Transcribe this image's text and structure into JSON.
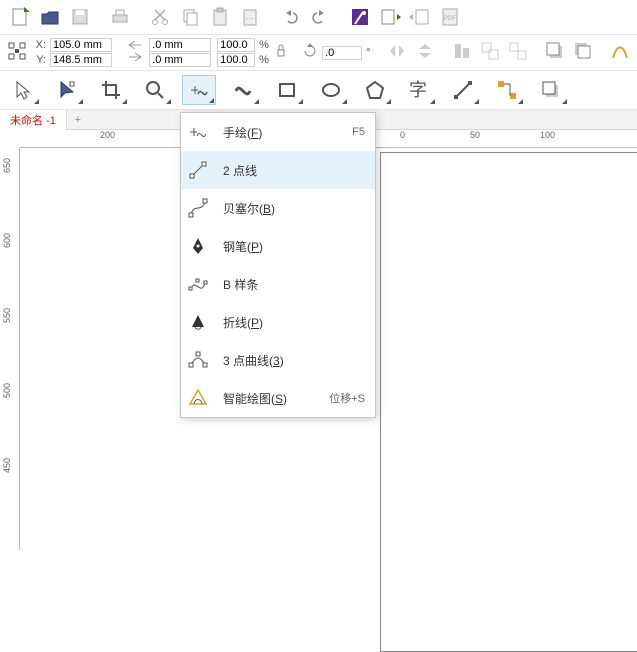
{
  "toolbar1": {
    "icons": [
      "new",
      "open",
      "save",
      "print",
      "cut",
      "copy",
      "paste",
      "paste-special",
      "undo",
      "redo",
      "fx",
      "plugin",
      "import",
      "export",
      "pdf"
    ]
  },
  "props": {
    "xy_icon": "obj-origin",
    "x_label": "X:",
    "x_value": "105.0 mm",
    "y_label": "Y:",
    "y_value": "148.5 mm",
    "w_label": "",
    "w_value": ".0 mm",
    "h_label": "",
    "h_value": ".0 mm",
    "sx_value": "100.0",
    "sy_value": "100.0",
    "pct": "%",
    "rot_value": ".0",
    "deg": "°"
  },
  "toolbox": [
    {
      "name": "pick",
      "active": false
    },
    {
      "name": "shape",
      "active": false
    },
    {
      "name": "crop",
      "active": false
    },
    {
      "name": "zoom",
      "active": false
    },
    {
      "name": "freehand",
      "active": true
    },
    {
      "name": "media",
      "active": false
    },
    {
      "name": "rect",
      "active": false
    },
    {
      "name": "ellipse",
      "active": false
    },
    {
      "name": "polygon",
      "active": false
    },
    {
      "name": "text",
      "active": false
    },
    {
      "name": "dimension",
      "active": false
    },
    {
      "name": "connector",
      "active": false
    },
    {
      "name": "effects",
      "active": false
    }
  ],
  "tabs": {
    "doc": "未命名 -1",
    "plus": "+"
  },
  "ruler_h": [
    {
      "pos": -40,
      "label": ""
    },
    {
      "pos": 80,
      "label": "200"
    },
    {
      "pos": 380,
      "label": "0"
    },
    {
      "pos": 450,
      "label": "50"
    },
    {
      "pos": 520,
      "label": "100"
    }
  ],
  "ruler_v": [
    {
      "pos": 10,
      "label": "650"
    },
    {
      "pos": 85,
      "label": "600"
    },
    {
      "pos": 160,
      "label": "550"
    },
    {
      "pos": 235,
      "label": "500"
    },
    {
      "pos": 310,
      "label": "450"
    }
  ],
  "flyout": {
    "items": [
      {
        "icon": "freehand",
        "label": "手绘(F)",
        "accel": "F5",
        "hover": false,
        "u": "F"
      },
      {
        "icon": "twopoint",
        "label": "2 点线",
        "accel": "",
        "hover": true,
        "u": ""
      },
      {
        "icon": "bezier",
        "label": "贝塞尔(B)",
        "accel": "",
        "hover": false,
        "u": "B"
      },
      {
        "icon": "pen",
        "label": "钢笔(P)",
        "accel": "",
        "hover": false,
        "u": "P"
      },
      {
        "icon": "bspline",
        "label": "B 样条",
        "accel": "",
        "hover": false,
        "u": ""
      },
      {
        "icon": "polyline",
        "label": "折线(P)",
        "accel": "",
        "hover": false,
        "u": "P"
      },
      {
        "icon": "threepoint",
        "label": "3 点曲线(3)",
        "accel": "",
        "hover": false,
        "u": "3"
      },
      {
        "icon": "smartdraw",
        "label": "智能绘图(S)",
        "accel": "位移+S",
        "hover": false,
        "u": "S"
      }
    ]
  }
}
